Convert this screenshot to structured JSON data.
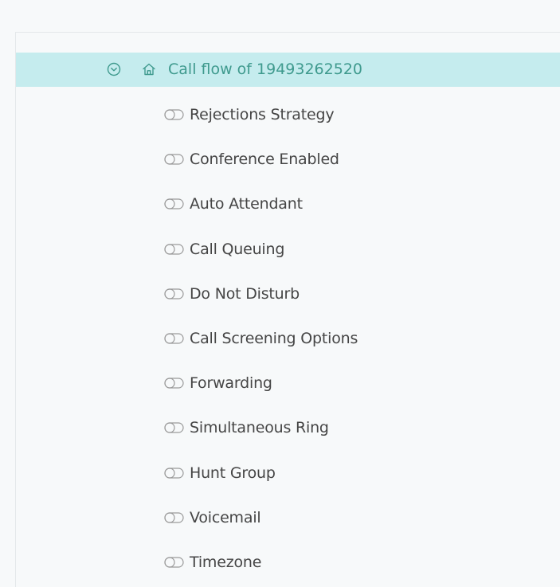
{
  "tree": {
    "root": {
      "label": "Call flow of 19493262520",
      "expand_icon": "chevron-down-circle-icon",
      "node_icon": "home-icon"
    },
    "children": [
      {
        "label": "Rejections Strategy",
        "icon": "toggle-off-icon"
      },
      {
        "label": "Conference Enabled",
        "icon": "toggle-off-icon"
      },
      {
        "label": "Auto Attendant",
        "icon": "toggle-off-icon"
      },
      {
        "label": "Call Queuing",
        "icon": "toggle-off-icon"
      },
      {
        "label": "Do Not Disturb",
        "icon": "toggle-off-icon"
      },
      {
        "label": "Call Screening Options",
        "icon": "toggle-off-icon"
      },
      {
        "label": "Forwarding",
        "icon": "toggle-off-icon"
      },
      {
        "label": "Simultaneous Ring",
        "icon": "toggle-off-icon"
      },
      {
        "label": "Hunt Group",
        "icon": "toggle-off-icon"
      },
      {
        "label": "Voicemail",
        "icon": "toggle-off-icon"
      },
      {
        "label": "Timezone",
        "icon": "toggle-off-icon"
      }
    ]
  },
  "colors": {
    "selected_row_bg": "#c5ecee",
    "root_text": "#3f9a8e",
    "child_text": "#454545",
    "toggle_stroke": "#9a9a9a"
  }
}
